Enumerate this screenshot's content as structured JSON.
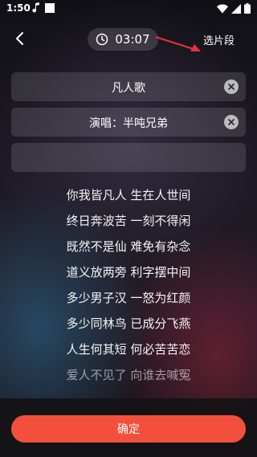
{
  "status_bar": {
    "time": "1:50"
  },
  "header": {
    "duration": "03:07",
    "select_segment_label": "选片段"
  },
  "fields": {
    "song_title": "凡人歌",
    "singer": "演唱：半吨兄弟",
    "extra": ""
  },
  "lyrics": [
    "你我皆凡人 生在人世间",
    "终日奔波苦 一刻不得闲",
    "既然不是仙 难免有杂念",
    "道义放两旁 利字摆中间",
    "多少男子汉 一怒为红颜",
    "多少同林鸟 已成分飞燕",
    "人生何其短 何必苦苦恋",
    "爱人不见了 向谁去喊冤"
  ],
  "footer": {
    "confirm_label": "确定"
  },
  "colors": {
    "accent": "#f2503d",
    "annotation_arrow": "#e8333a"
  }
}
